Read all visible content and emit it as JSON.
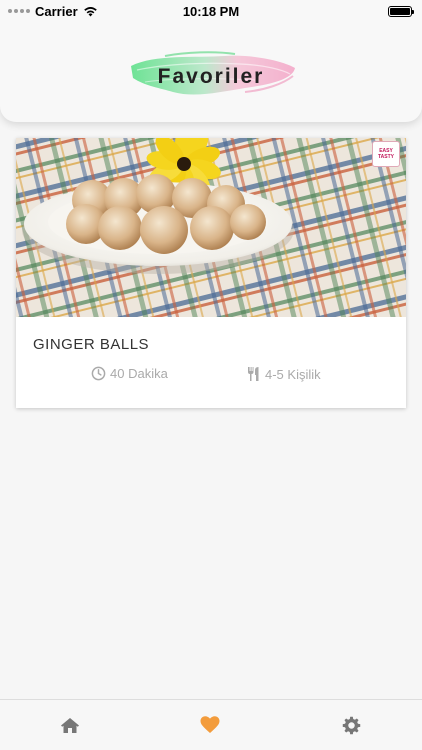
{
  "status_bar": {
    "carrier": "Carrier",
    "time": "10:18 PM",
    "signal_icon": "signal-dots-icon",
    "wifi_icon": "wifi-icon",
    "battery_icon": "battery-icon",
    "battery_level": 1.0
  },
  "header": {
    "title": "Favoriler",
    "brush_colors": [
      "#5fe08a",
      "#f3a8c8"
    ]
  },
  "recipes": [
    {
      "title": "GINGER BALLS",
      "duration": "40 Dakika",
      "duration_icon": "clock-icon",
      "servings": "4-5 Kişilik",
      "servings_icon": "fork-knife-icon",
      "image": "ginger-balls-photo"
    }
  ],
  "tabbar": {
    "items": [
      {
        "icon": "home-icon",
        "active": false
      },
      {
        "icon": "heart-icon",
        "active": true
      },
      {
        "icon": "gear-icon",
        "active": false
      }
    ],
    "active_color": "#f39c3c",
    "inactive_color": "#777777"
  }
}
